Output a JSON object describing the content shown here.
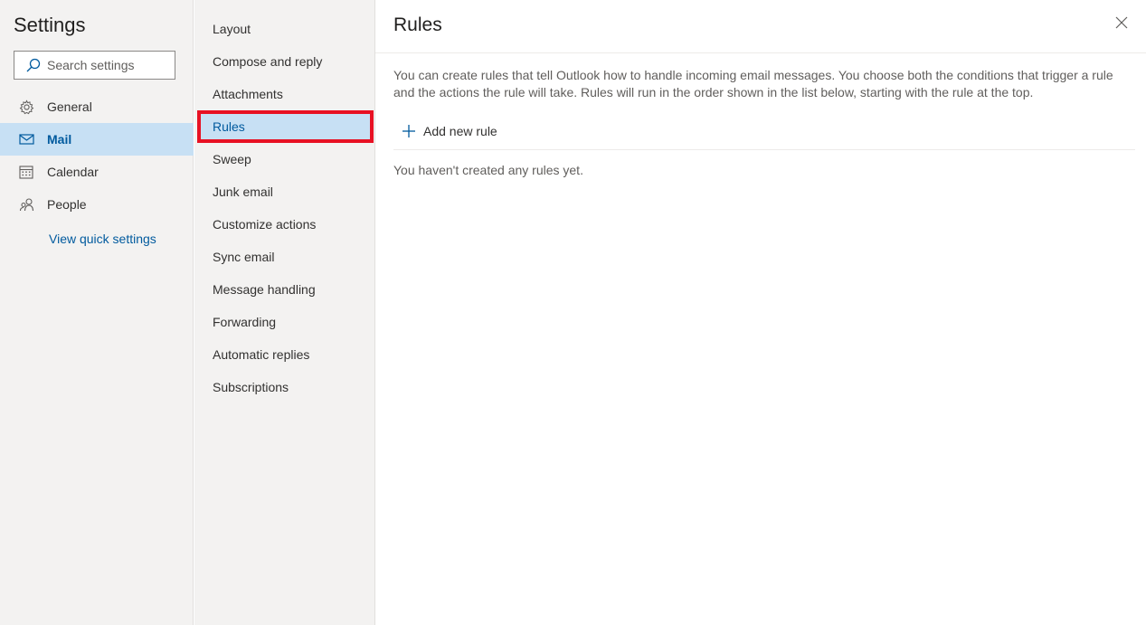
{
  "settings": {
    "title": "Settings",
    "search_placeholder": "Search settings"
  },
  "nav": {
    "items": [
      {
        "label": "General",
        "icon": "gear-icon"
      },
      {
        "label": "Mail",
        "icon": "mail-icon",
        "selected": true
      },
      {
        "label": "Calendar",
        "icon": "calendar-icon"
      },
      {
        "label": "People",
        "icon": "people-icon"
      }
    ],
    "quick_settings_link": "View quick settings"
  },
  "sub_nav": {
    "items": [
      {
        "label": "Layout"
      },
      {
        "label": "Compose and reply"
      },
      {
        "label": "Attachments"
      },
      {
        "label": "Rules",
        "selected": true
      },
      {
        "label": "Sweep"
      },
      {
        "label": "Junk email"
      },
      {
        "label": "Customize actions"
      },
      {
        "label": "Sync email"
      },
      {
        "label": "Message handling"
      },
      {
        "label": "Forwarding"
      },
      {
        "label": "Automatic replies"
      },
      {
        "label": "Subscriptions"
      }
    ]
  },
  "content": {
    "title": "Rules",
    "description": "You can create rules that tell Outlook how to handle incoming email messages. You choose both the conditions that trigger a rule and the actions the rule will take. Rules will run in the order shown in the list below, starting with the rule at the top.",
    "add_rule_label": "Add new rule",
    "empty_message": "You haven't created any rules yet."
  },
  "colors": {
    "accent": "#005a9e",
    "selected_bg": "#c7e0f4",
    "highlight_border": "#e81123",
    "pane_bg": "#f3f2f1"
  }
}
